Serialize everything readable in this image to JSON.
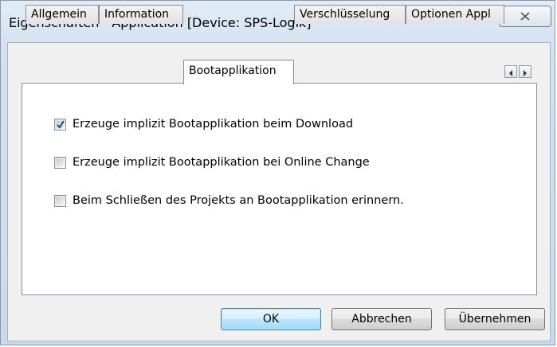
{
  "window": {
    "title": "Eigenschaften - Application [Device: SPS-Logik]",
    "close_icon": "close-x-icon"
  },
  "tabs": [
    {
      "label": "Allgemein",
      "active": false
    },
    {
      "label": "Information",
      "active": false
    },
    {
      "label": "Bootapplikation",
      "active": true
    },
    {
      "label": "Verschlüsselung",
      "active": false
    },
    {
      "label": "Optionen Appl",
      "active": false
    }
  ],
  "tab_scroll": {
    "left_icon": "arrow-left-icon",
    "right_icon": "arrow-right-icon"
  },
  "options": [
    {
      "label": "Erzeuge implizit Bootapplikation beim Download",
      "checked": true
    },
    {
      "label": "Erzeuge implizit Bootapplikation bei Online Change",
      "checked": false
    },
    {
      "label": "Beim Schließen des Projekts an Bootapplikation erinnern.",
      "checked": false
    }
  ],
  "buttons": {
    "ok": "OK",
    "cancel": "Abbrechen",
    "apply": "Übernehmen"
  },
  "colors": {
    "window_frame": "#d3e1f1",
    "default_button": "#bee6fd",
    "checkmark": "#2a4f8c"
  }
}
